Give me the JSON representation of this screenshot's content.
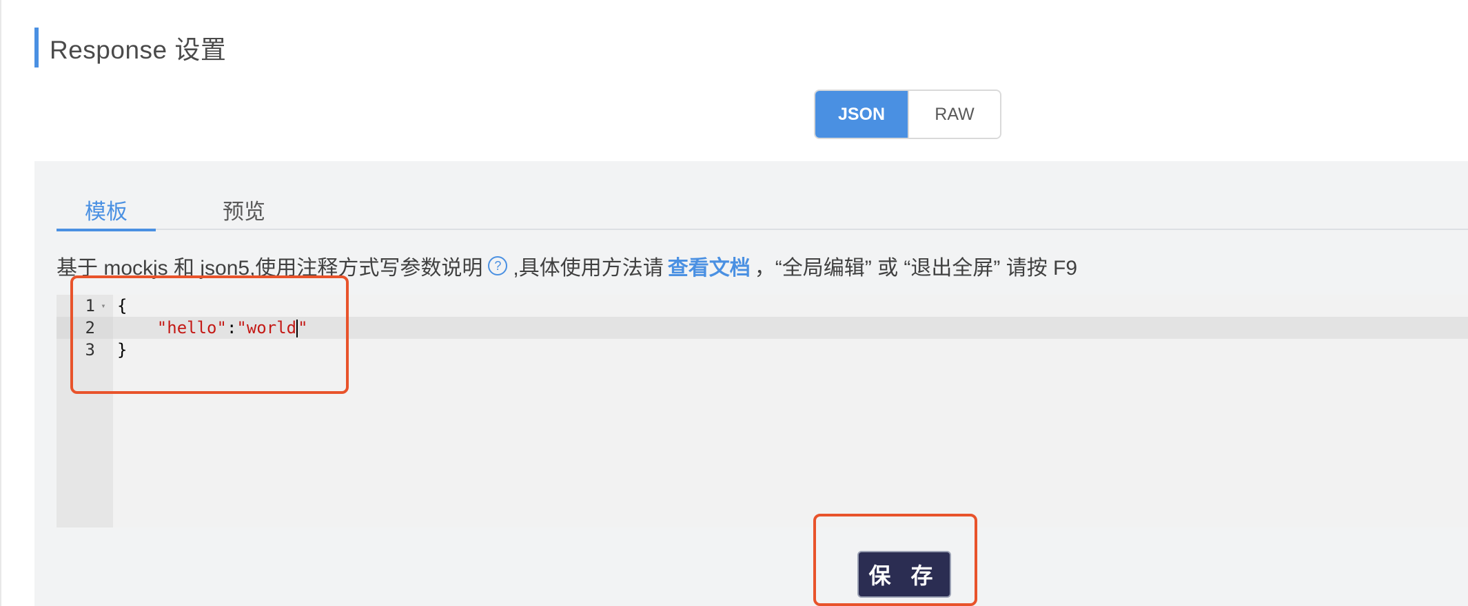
{
  "section": {
    "title": "Response 设置"
  },
  "mode_toggle": {
    "options": [
      "JSON",
      "RAW"
    ],
    "selected": "JSON"
  },
  "tabs": [
    {
      "label": "模板",
      "active": true
    },
    {
      "label": "预览",
      "active": false
    }
  ],
  "hint": {
    "prefix": "基于 mockjs 和 json5,使用注释方式写参数说明",
    "help_icon": "question-circle-icon",
    "middle": ",具体使用方法请",
    "link": "查看文档",
    "suffix": "，“全局编辑” 或 “退出全屏” 请按 F9"
  },
  "editor": {
    "lines": [
      {
        "number": "1",
        "text": "{"
      },
      {
        "number": "2",
        "key": "\"hello\"",
        "sep": ":",
        "value": "\"world\""
      },
      {
        "number": "3",
        "text": "}"
      }
    ],
    "active_line": 2
  },
  "save_button": {
    "label": "保 存"
  },
  "colors": {
    "accent": "#4a90e2",
    "highlight_box": "#e8532b",
    "save_button_bg": "#2b2d52",
    "string": "#c41a16"
  }
}
